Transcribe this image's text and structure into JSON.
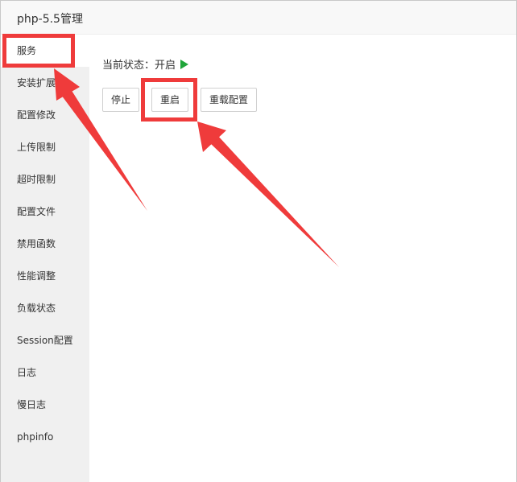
{
  "window": {
    "title": "php-5.5管理"
  },
  "sidebar": {
    "items": [
      {
        "label": "服务",
        "active": true
      },
      {
        "label": "安装扩展"
      },
      {
        "label": "配置修改"
      },
      {
        "label": "上传限制"
      },
      {
        "label": "超时限制"
      },
      {
        "label": "配置文件"
      },
      {
        "label": "禁用函数"
      },
      {
        "label": "性能调整"
      },
      {
        "label": "负载状态"
      },
      {
        "label": "Session配置"
      },
      {
        "label": "日志"
      },
      {
        "label": "慢日志"
      },
      {
        "label": "phpinfo"
      }
    ]
  },
  "service": {
    "status_text": "当前状态：开启",
    "status_icon": "play-icon",
    "status_color": "#20a53a",
    "buttons": {
      "stop": "停止",
      "restart": "重启",
      "reload": "重载配置"
    }
  },
  "annotation": {
    "color": "#ef3b3b"
  }
}
